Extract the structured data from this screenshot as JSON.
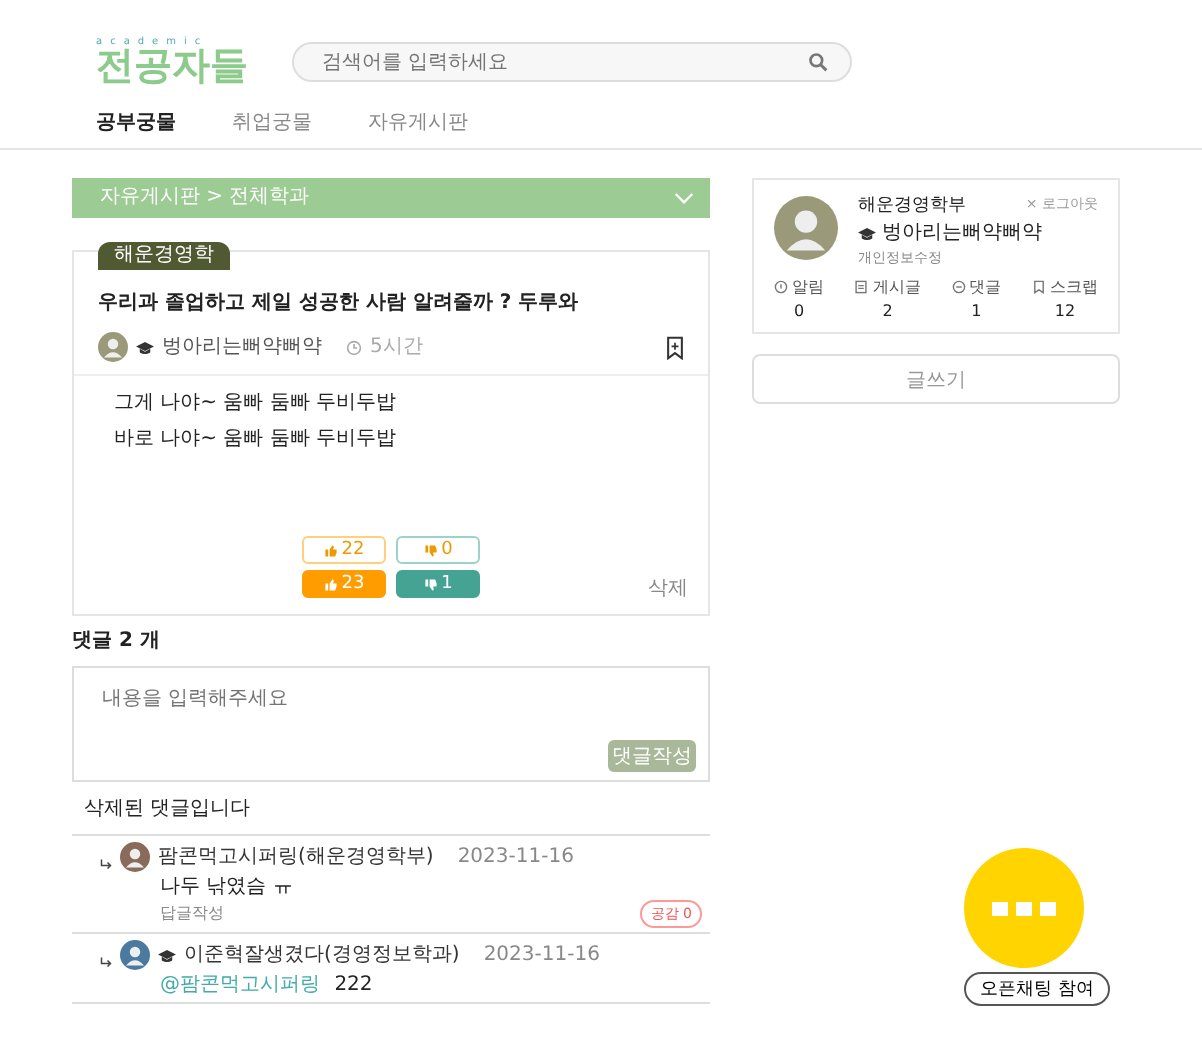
{
  "logo": {
    "tagline": "academic",
    "title": "전공자들"
  },
  "search": {
    "placeholder": "검색어를 입력하세요"
  },
  "tabs": [
    {
      "label": "공부궁물",
      "selected": true
    },
    {
      "label": "취업궁물",
      "selected": false
    },
    {
      "label": "자유게시판",
      "selected": false
    }
  ],
  "breadcrumb": "자유게시판 > 전체학과",
  "post": {
    "tag": "해운경영학",
    "title": "우리과 졸업하고 제일 성공한 사람 알려줄까 ? 두루와",
    "author": "벙아리는뻐약뻐약",
    "time": "5시간",
    "bookmarked": false,
    "body": [
      "그게 나야~ 움빠 둠빠 두비두밥",
      "바로 나야~ 움빠 둠빠 두비두밥"
    ],
    "reactions": [
      {
        "kind": "like",
        "count": "22",
        "filled": false
      },
      {
        "kind": "dislike",
        "count": "0",
        "filled": false
      },
      {
        "kind": "like",
        "count": "23",
        "filled": true
      },
      {
        "kind": "dislike",
        "count": "1",
        "filled": true
      }
    ],
    "delete": "삭제"
  },
  "comments_title": "댓글 2 개",
  "comment_input": {
    "placeholder": "내용을 입력해주세요",
    "submit": "댓글작성"
  },
  "deleted_comment": "삭제된 댓글입니다",
  "replies": [
    {
      "author": "팜콘먹고시퍼링(해운경영학부)",
      "badge": false,
      "date": "2023-11-16",
      "text": "나두 낚였슴 ㅠ",
      "reply": "답글작성",
      "like": "공감 0"
    },
    {
      "author": "이준혁잘생겼다(경영정보학과)",
      "badge": true,
      "date": "2023-11-16",
      "mention": "@팜콘먹고시퍼링",
      "text": "222"
    }
  ],
  "profile": {
    "department": "해운경영학부",
    "logout": "× 로그아웃",
    "nickname": "벙아리는뻐약뻐약",
    "edit": "개인정보수정",
    "stats": [
      {
        "kind": "alarm",
        "label": "알림",
        "value": "0"
      },
      {
        "kind": "post",
        "label": "게시글",
        "value": "2"
      },
      {
        "kind": "comment",
        "label": "댓글",
        "value": "1"
      },
      {
        "kind": "scrap",
        "label": "스크랩",
        "value": "12"
      }
    ]
  },
  "write_button": "글쓰기",
  "open_chat": "오픈채팅 참여"
}
